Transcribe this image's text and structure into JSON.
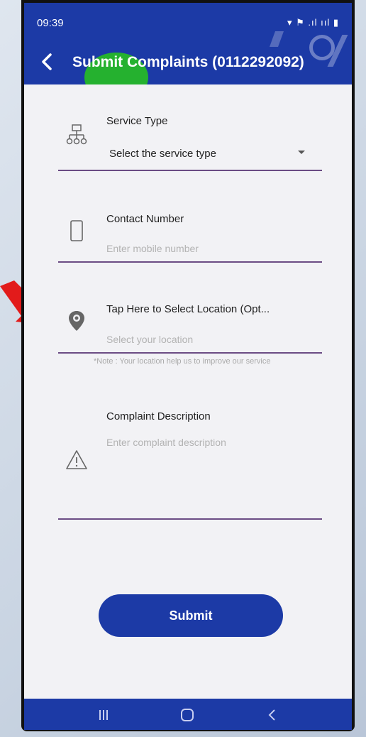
{
  "status_bar": {
    "time": "09:39",
    "icons": "▾ ⚑ .ıl ııl ▮"
  },
  "header": {
    "title": "Submit Complaints (0112292092)"
  },
  "fields": {
    "service_type": {
      "label": "Service Type",
      "value": "Select the service type"
    },
    "contact_number": {
      "label": "Contact Number",
      "placeholder": "Enter mobile number"
    },
    "location": {
      "label": "Tap Here to Select Location (Opt...",
      "placeholder": "Select your location",
      "note": "*Note : Your location help us to improve our service"
    },
    "description": {
      "label": "Complaint Description",
      "placeholder": "Enter complaint description"
    }
  },
  "submit_label": "Submit",
  "colors": {
    "primary": "#1c3aa6",
    "accent_green": "#25b12f",
    "underline": "#6b4c84",
    "arrow": "#e21b1b"
  },
  "nav": [
    "recent-apps-icon",
    "home-icon",
    "back-icon"
  ]
}
